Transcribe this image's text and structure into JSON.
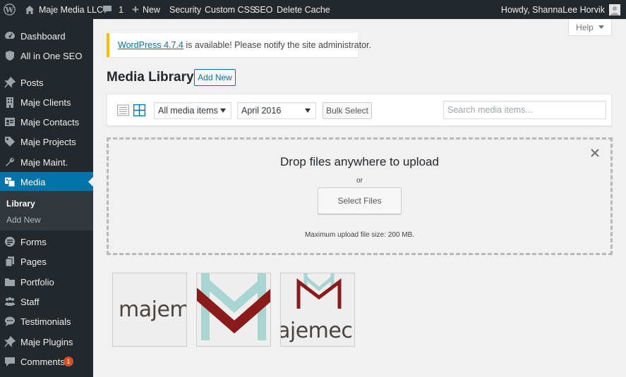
{
  "admin_bar": {
    "site_name": "Maje Media LLC",
    "comments_count": "1",
    "new_label": "New",
    "links": [
      "Security",
      "Custom CSS",
      "SEO",
      "Delete Cache"
    ],
    "greeting": "Howdy, ShannaLee Horvik"
  },
  "sidebar": {
    "items": [
      {
        "label": "Dashboard",
        "icon": "dashboard-icon"
      },
      {
        "label": "All in One SEO",
        "icon": "shield-icon"
      },
      {
        "label": "Posts",
        "icon": "pushpin-icon"
      },
      {
        "label": "Maje Clients",
        "icon": "building-icon"
      },
      {
        "label": "Maje Contacts",
        "icon": "id-card-icon"
      },
      {
        "label": "Maje Projects",
        "icon": "tag-icon"
      },
      {
        "label": "Maje Maint.",
        "icon": "wrench-icon"
      },
      {
        "label": "Media",
        "icon": "media-icon"
      },
      {
        "label": "Forms",
        "icon": "forms-icon"
      },
      {
        "label": "Pages",
        "icon": "pages-icon"
      },
      {
        "label": "Portfolio",
        "icon": "folder-icon"
      },
      {
        "label": "Staff",
        "icon": "people-icon"
      },
      {
        "label": "Testimonials",
        "icon": "speech-bubble-icon"
      },
      {
        "label": "Maje Plugins",
        "icon": "pushpin-icon"
      },
      {
        "label": "Comments",
        "icon": "comment-icon"
      }
    ],
    "submenu": {
      "library": "Library",
      "add_new": "Add New"
    },
    "comments_badge": "1"
  },
  "help": {
    "label": "Help"
  },
  "notice": {
    "link_text": "WordPress 4.7.4",
    "message": " is available! Please notify the site administrator."
  },
  "page": {
    "title": "Media Library",
    "add_new": "Add New"
  },
  "toolbar": {
    "filter_type": "All media items",
    "filter_date": "April 2016",
    "bulk_select": "Bulk Select",
    "search_placeholder": "Search media items..."
  },
  "uploader": {
    "title": "Drop files anywhere to upload",
    "or": "or",
    "button": "Select Files",
    "max_size": "Maximum upload file size: 200 MB."
  },
  "thumbnails": [
    {
      "text": "majem"
    },
    {
      "text": ""
    },
    {
      "text": "ajemec"
    }
  ],
  "colors": {
    "admin_bar": "#23282d",
    "accent": "#0073aa",
    "notice_border": "#ffb900",
    "logo_red": "#8b1a1a",
    "logo_teal": "#a8d5d1",
    "logo_text": "#4a4440"
  }
}
